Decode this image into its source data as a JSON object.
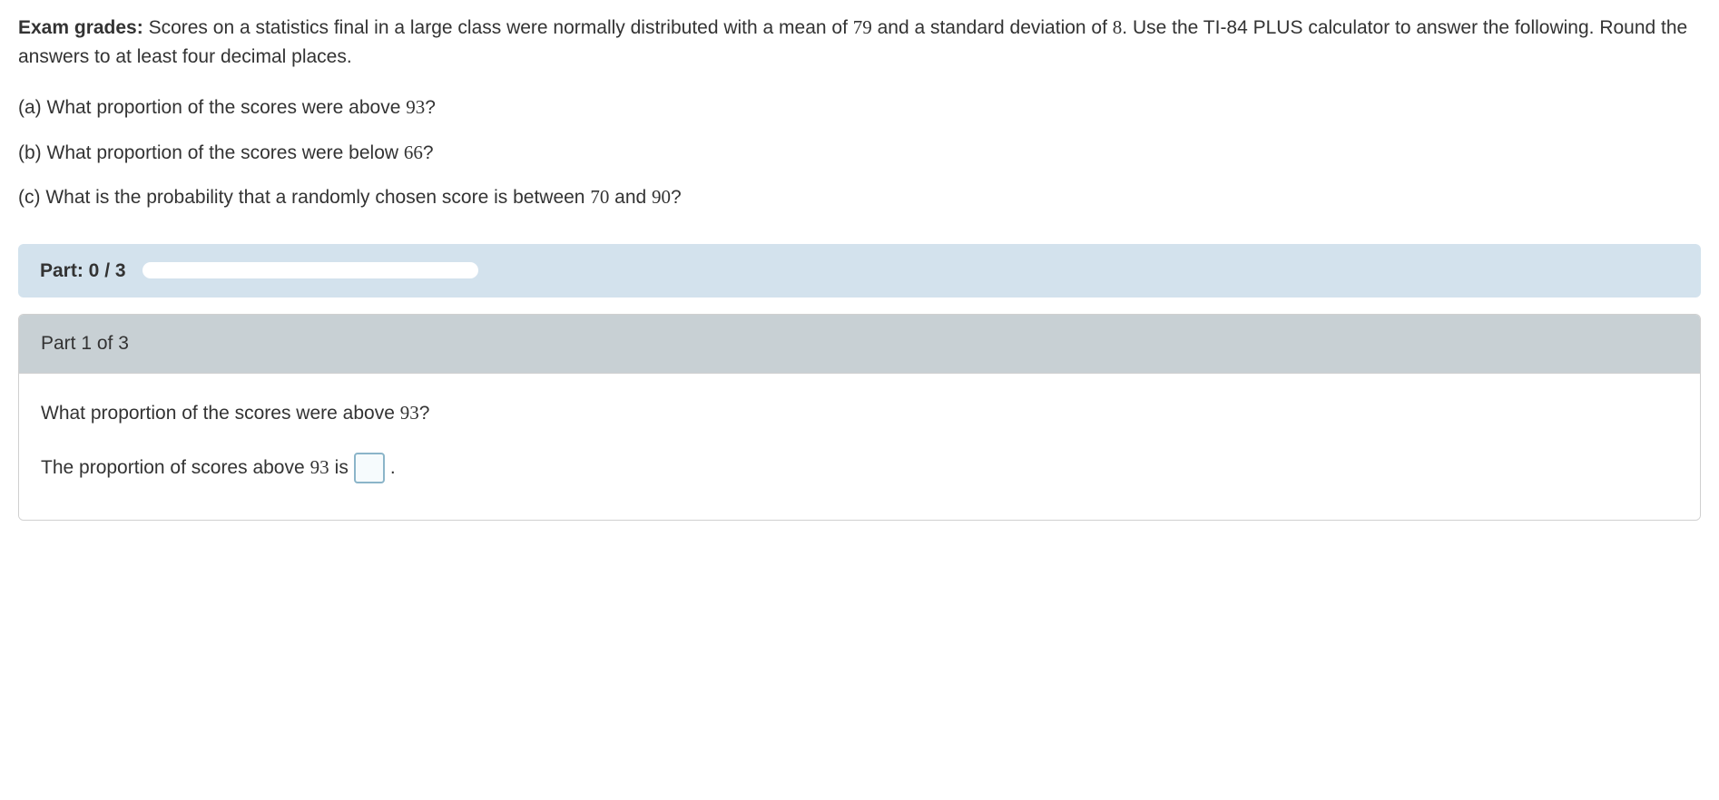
{
  "problem": {
    "titleBold": "Exam grades:",
    "intro1": " Scores on a statistics final in a large class were normally distributed with a mean of ",
    "mean": "79",
    "intro2": " and a standard deviation of ",
    "sd": "8",
    "intro3": ". Use the TI-84 PLUS calculator to answer the following. Round the answers to at least four decimal places."
  },
  "questions": {
    "a": {
      "label": "(a)",
      "text1": " What proportion of the scores were above ",
      "val": "93",
      "text2": "?"
    },
    "b": {
      "label": "(b)",
      "text1": " What proportion of the scores were below ",
      "val": "66",
      "text2": "?"
    },
    "c": {
      "label": "(c)",
      "text1": " What is the probability that a randomly chosen score is between ",
      "val1": "70",
      "and": " and ",
      "val2": "90",
      "text2": "?"
    }
  },
  "progress": {
    "label": "Part: 0 / 3"
  },
  "part1": {
    "header": "Part 1 of 3",
    "question1": "What proportion of the scores were above ",
    "questionVal": "93",
    "question2": "?",
    "answer1": "The proportion of scores above ",
    "answerVal": "93",
    "answer2": " is ",
    "answer3": "."
  }
}
